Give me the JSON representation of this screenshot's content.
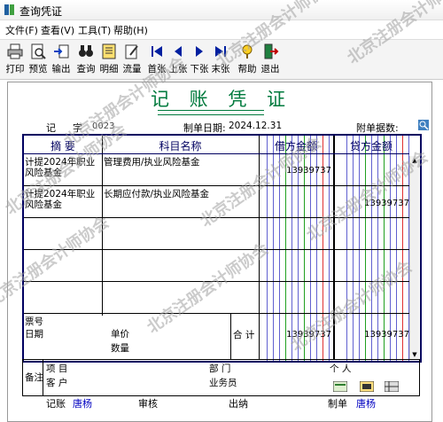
{
  "window": {
    "title": "查询凭证"
  },
  "menu": [
    "文件(F)",
    "查看(V)",
    "工具(T)",
    "帮助(H)"
  ],
  "toolbar": [
    {
      "label": "打印",
      "icon": "printer-icon"
    },
    {
      "label": "预览",
      "icon": "preview-icon"
    },
    {
      "label": "输出",
      "icon": "export-icon"
    },
    {
      "label": "查询",
      "icon": "binoculars-icon"
    },
    {
      "label": "明细",
      "icon": "detail-icon"
    },
    {
      "label": "流量",
      "icon": "flow-icon"
    },
    {
      "label": "首张",
      "icon": "first-icon"
    },
    {
      "label": "上张",
      "icon": "prev-icon"
    },
    {
      "label": "下张",
      "icon": "next-icon"
    },
    {
      "label": "末张",
      "icon": "last-icon"
    },
    {
      "label": "帮助",
      "icon": "help-icon"
    },
    {
      "label": "退出",
      "icon": "exit-icon"
    }
  ],
  "voucher": {
    "title": "记 账 凭 证",
    "type_label": "记",
    "zi_label": "字",
    "number": "0023",
    "date_label": "制单日期:",
    "date": "2024.12.31",
    "attach_label": "附单据数:",
    "columns": {
      "summary": "摘 要",
      "account": "科目名称",
      "debit": "借方金额",
      "credit": "贷方金额"
    },
    "entries": [
      {
        "summary": "计提2024年职业风险基金",
        "account": "管理费用/执业风险基金",
        "debit": "13939737",
        "credit": ""
      },
      {
        "summary": "计提2024年职业风险基金",
        "account": "长期应付款/执业风险基金",
        "debit": "",
        "credit": "13939737"
      }
    ],
    "bottom": {
      "ticket_no": "票号",
      "date": "日期",
      "unit_price": "单价",
      "quantity": "数量",
      "total_label": "合 计",
      "total_debit": "13939737",
      "total_credit": "13939737",
      "remark": "备注",
      "project": "项 目",
      "customer": "客 户",
      "department": "部 门",
      "salesman": "业务员",
      "person": "个 人"
    },
    "footer": {
      "bookkeep_label": "记账",
      "bookkeeper": "唐杨",
      "review_label": "审核",
      "cashier_label": "出纳",
      "maker_label": "制单",
      "maker": "唐杨"
    }
  },
  "watermark": "北京注册会计师协会"
}
